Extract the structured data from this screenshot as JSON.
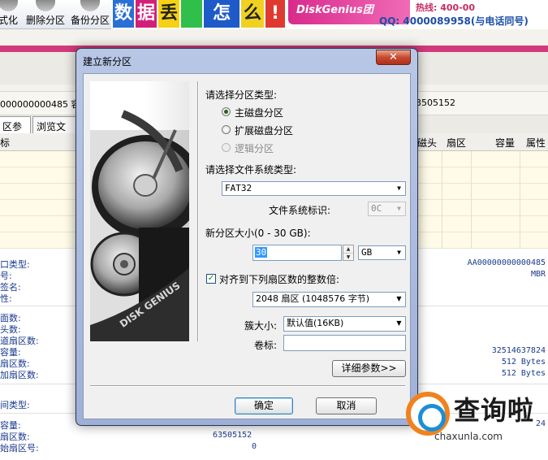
{
  "app": {
    "toolbar": [
      {
        "label": "式化"
      },
      {
        "label": "删除分区"
      },
      {
        "label": "备份分区"
      }
    ],
    "banner": {
      "chars": [
        "数",
        "据",
        "丢",
        "",
        "怎",
        "么",
        "!"
      ],
      "brand": "DiskGenius团",
      "phone": "热线: 400-00",
      "qq": "QQ: 4000089958(与电话同号)"
    },
    "info_row": {
      "left": "000000000485  容",
      "right": "3505152"
    },
    "tabs": [
      {
        "label": "区参数"
      },
      {
        "label": "浏览文件"
      }
    ],
    "grid_headers": {
      "first": "标",
      "right": [
        "磁头",
        "扇区",
        "容量",
        "属性"
      ]
    },
    "props": {
      "labels": [
        "口类型:",
        "号:",
        "签名:",
        "性:",
        "面数:",
        "头数:",
        "道扇区数:",
        "容量:",
        "扇区数:",
        "加扇区数:",
        "间类型:",
        "容量:",
        "扇区数:",
        "始扇区号:"
      ],
      "values": {
        "disk_id": "AA00000000000485",
        "partition_style": "MBR",
        "total_bytes": "32514637824",
        "sector_size": "512 Bytes",
        "phys_sector_size": "512 Bytes",
        "bottom_right": "24",
        "sectors": "63505152",
        "start_sector": "0"
      }
    }
  },
  "dialog": {
    "title": "建立新分区",
    "close_glyph": "✕",
    "art_text": "DISK GENIUS",
    "partition_type": {
      "label": "请选择分区类型:",
      "options": [
        {
          "label": "主磁盘分区",
          "selected": true,
          "enabled": true
        },
        {
          "label": "扩展磁盘分区",
          "selected": false,
          "enabled": true
        },
        {
          "label": "逻辑分区",
          "selected": false,
          "enabled": false
        }
      ]
    },
    "filesystem": {
      "label": "请选择文件系统类型:",
      "value": "FAT32",
      "id_label": "文件系统标识:",
      "id_value": "0C"
    },
    "size": {
      "label": "新分区大小(0 - 30 GB):",
      "value": "30",
      "unit": "GB"
    },
    "align": {
      "checked": true,
      "label": "对齐到下列扇区数的整数倍:",
      "value": "2048 扇区 (1048576 字节)"
    },
    "cluster": {
      "label": "簇大小:",
      "value": "默认值(16KB)"
    },
    "volume": {
      "label": "卷标:",
      "value": ""
    },
    "buttons": {
      "details": "详细参数>>",
      "ok": "确定",
      "cancel": "取消"
    }
  },
  "watermark": {
    "title": "查询啦",
    "url": "chaxunla.com"
  },
  "colors": {
    "accent_pink": "#d33a7c",
    "prop_text": "#1a3a8f",
    "dialog_frame": "#9fb0d8",
    "watermark_orange": "#f0821e",
    "watermark_blue": "#1a8fd8"
  },
  "icons": [
    "close-icon",
    "dropdown-arrow-icon",
    "spin-up-icon",
    "spin-down-icon",
    "checkmark-icon",
    "hard-disk-image",
    "search-logo-icon"
  ]
}
